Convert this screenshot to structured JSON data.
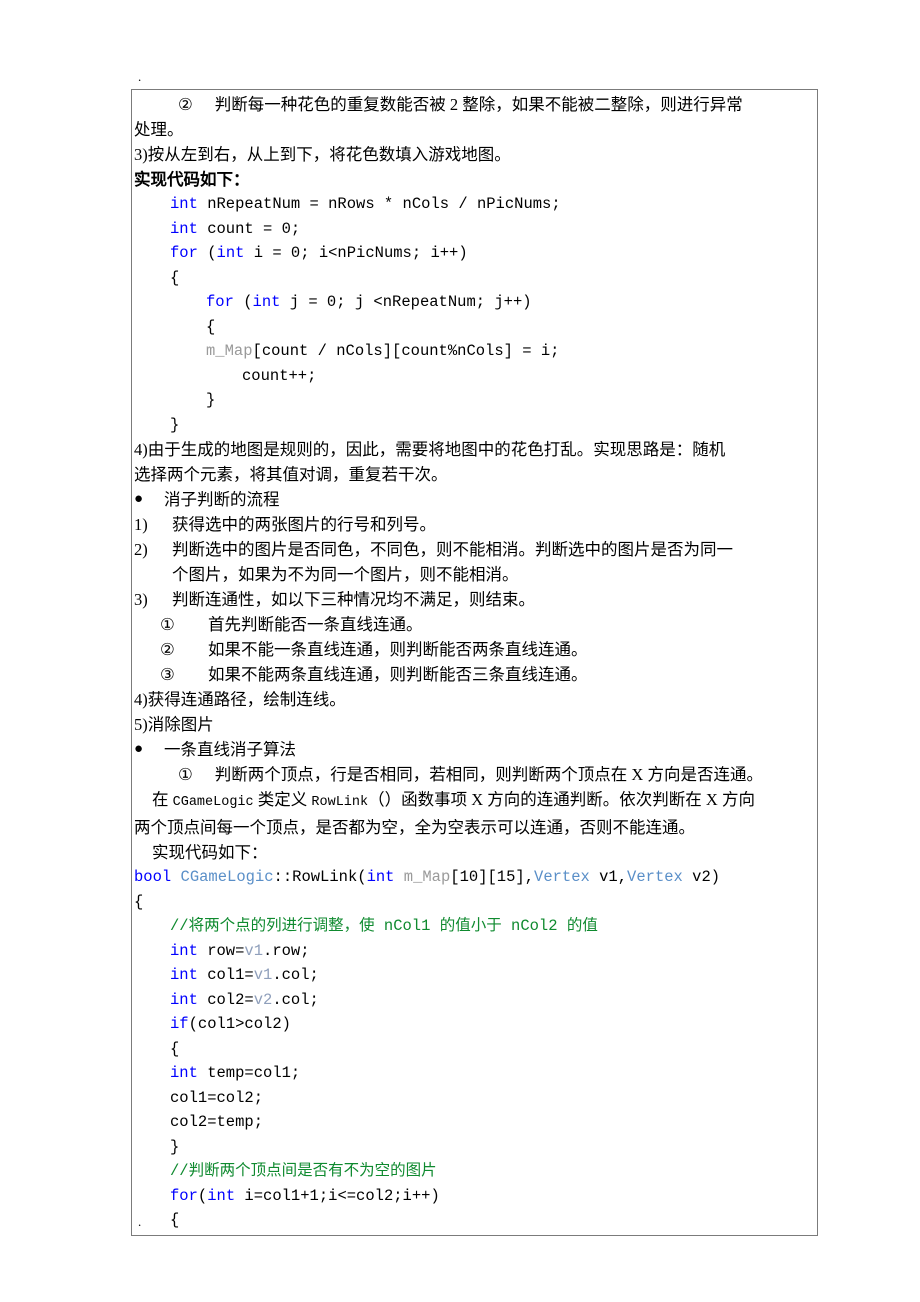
{
  "document": {
    "stray_mark_top": ".",
    "stray_mark_bottom": ".",
    "frame_border_color": "#7b7b7b"
  },
  "colors": {
    "keyword": "#0000ff",
    "class": "#5a8fc8",
    "variable": "#9a9a9a",
    "comment": "#0f8a2f",
    "text": "#000000"
  },
  "content": {
    "item_circle2": {
      "marker": "②",
      "text": "判断每一种花色的重复数能否被 2 整除，如果不能被二整除，则进行异常"
    },
    "item_circle2_cont": "处理。",
    "item_3": "3)按从左到右，从上到下，将花色数填入游戏地图。",
    "heading_code_1": "实现代码如下：",
    "code_block_1": [
      {
        "indent": 1,
        "tokens": [
          {
            "t": "int",
            "c": "kw"
          },
          {
            "t": " nRepeatNum = nRows * nCols / nPicNums;",
            "c": ""
          }
        ]
      },
      {
        "indent": 1,
        "tokens": [
          {
            "t": "int",
            "c": "kw"
          },
          {
            "t": " count = 0;",
            "c": ""
          }
        ]
      },
      {
        "indent": 1,
        "tokens": [
          {
            "t": "for",
            "c": "kw"
          },
          {
            "t": " (",
            "c": ""
          },
          {
            "t": "int",
            "c": "kw"
          },
          {
            "t": " i = 0; i<nPicNums; i++)",
            "c": ""
          }
        ]
      },
      {
        "indent": 1,
        "tokens": [
          {
            "t": "{",
            "c": ""
          }
        ]
      },
      {
        "indent": 2,
        "tokens": [
          {
            "t": "for",
            "c": "kw"
          },
          {
            "t": " (",
            "c": ""
          },
          {
            "t": "int",
            "c": "kw"
          },
          {
            "t": " j = 0; j <nRepeatNum; j++)",
            "c": ""
          }
        ]
      },
      {
        "indent": 2,
        "tokens": [
          {
            "t": "{",
            "c": ""
          }
        ]
      },
      {
        "indent": 2,
        "tokens": [
          {
            "t": "m_Map",
            "c": "var"
          },
          {
            "t": "[count / nCols][count%nCols] = i;",
            "c": ""
          }
        ]
      },
      {
        "indent": 3,
        "tokens": [
          {
            "t": "count++;",
            "c": ""
          }
        ]
      },
      {
        "indent": 2,
        "tokens": [
          {
            "t": "}",
            "c": ""
          }
        ]
      },
      {
        "indent": 1,
        "tokens": [
          {
            "t": "}",
            "c": ""
          }
        ]
      }
    ],
    "item_4_line1": "4)由于生成的地图是规则的，因此，需要将地图中的花色打乱。实现思路是：随机",
    "item_4_line2": "选择两个元素，将其值对调，重复若干次。",
    "bullet_1": {
      "bullet": "●",
      "text": "消子判断的流程"
    },
    "num_list": [
      {
        "marker": "1)",
        "lines": [
          "获得选中的两张图片的行号和列号。"
        ]
      },
      {
        "marker": "2)",
        "lines": [
          "判断选中的图片是否同色，不同色，则不能相消。判断选中的图片是否为同一",
          "个图片，如果为不为同一个图片，则不能相消。"
        ]
      },
      {
        "marker": "3)",
        "lines": [
          "判断连通性，如以下三种情况均不满足，则结束。"
        ]
      }
    ],
    "sub_list": [
      {
        "marker": "①",
        "text": "首先判断能否一条直线连通。"
      },
      {
        "marker": "②",
        "text": "如果不能一条直线连通，则判断能否两条直线连通。"
      },
      {
        "marker": "③",
        "text": "如果不能两条直线连通，则判断能否三条直线连通。"
      }
    ],
    "item_4b": "4)获得连通路径，绘制连线。",
    "item_5": "5)消除图片",
    "bullet_2": {
      "bullet": "●",
      "text": "一条直线消子算法"
    },
    "sub_item_1": {
      "marker": "①",
      "text": "判断两个顶点，行是否相同，若相同，则判断两个顶点在 X 方向是否连通。"
    },
    "para_rowlink_1_pre": "在 ",
    "para_rowlink_1_mono1": "CGameLogic",
    "para_rowlink_1_mid": " 类定义 ",
    "para_rowlink_1_mono2": "RowLink",
    "para_rowlink_1_post": "（）函数事项 X 方向的连通判断。依次判断在 X 方向",
    "para_rowlink_2": "两个顶点间每一个顶点，是否都为空，全为空表示可以连通，否则不能连通。",
    "heading_code_2": "实现代码如下：",
    "code_block_2": [
      {
        "indent": 0,
        "tokens": [
          {
            "t": "bool",
            "c": "kw"
          },
          {
            "t": " ",
            "c": ""
          },
          {
            "t": "CGameLogic",
            "c": "cls"
          },
          {
            "t": "::RowLink(",
            "c": ""
          },
          {
            "t": "int",
            "c": "kw"
          },
          {
            "t": " ",
            "c": ""
          },
          {
            "t": "m_Map",
            "c": "var"
          },
          {
            "t": "[10][15],",
            "c": ""
          },
          {
            "t": "Vertex",
            "c": "cls"
          },
          {
            "t": " v1,",
            "c": ""
          },
          {
            "t": "Vertex",
            "c": "cls"
          },
          {
            "t": " v2)",
            "c": ""
          }
        ]
      },
      {
        "indent": 0,
        "tokens": [
          {
            "t": "{",
            "c": ""
          }
        ]
      },
      {
        "indent": 1,
        "tokens": [
          {
            "t": "//将两个点的列进行调整，使 nCol1 的值小于 nCol2 的值",
            "c": "cmt"
          }
        ]
      },
      {
        "indent": 1,
        "tokens": [
          {
            "t": "int",
            "c": "kw"
          },
          {
            "t": " row=",
            "c": ""
          },
          {
            "t": "v1",
            "c": "lvar"
          },
          {
            "t": ".row;",
            "c": ""
          }
        ]
      },
      {
        "indent": 1,
        "tokens": [
          {
            "t": "int",
            "c": "kw"
          },
          {
            "t": " col1=",
            "c": ""
          },
          {
            "t": "v1",
            "c": "lvar"
          },
          {
            "t": ".col;",
            "c": ""
          }
        ]
      },
      {
        "indent": 1,
        "tokens": [
          {
            "t": "int",
            "c": "kw"
          },
          {
            "t": " col2=",
            "c": ""
          },
          {
            "t": "v2",
            "c": "lvar"
          },
          {
            "t": ".col;",
            "c": ""
          }
        ]
      },
      {
        "indent": 1,
        "tokens": [
          {
            "t": "if",
            "c": "kw"
          },
          {
            "t": "(col1>col2)",
            "c": ""
          }
        ]
      },
      {
        "indent": 1,
        "tokens": [
          {
            "t": "{",
            "c": ""
          }
        ]
      },
      {
        "indent": 1,
        "tokens": [
          {
            "t": "int",
            "c": "kw"
          },
          {
            "t": " temp=col1;",
            "c": ""
          }
        ]
      },
      {
        "indent": 1,
        "tokens": [
          {
            "t": "col1=col2;",
            "c": ""
          }
        ]
      },
      {
        "indent": 1,
        "tokens": [
          {
            "t": "col2=temp;",
            "c": ""
          }
        ]
      },
      {
        "indent": 1,
        "tokens": [
          {
            "t": "}",
            "c": ""
          }
        ]
      },
      {
        "indent": 1,
        "tokens": [
          {
            "t": "//判断两个顶点间是否有不为空的图片",
            "c": "cmt"
          }
        ]
      },
      {
        "indent": 1,
        "tokens": [
          {
            "t": "for",
            "c": "kw"
          },
          {
            "t": "(",
            "c": ""
          },
          {
            "t": "int",
            "c": "kw"
          },
          {
            "t": " i=col1+1;i<=col2;i++)",
            "c": ""
          }
        ]
      },
      {
        "indent": 1,
        "tokens": [
          {
            "t": "{",
            "c": ""
          }
        ]
      }
    ]
  }
}
